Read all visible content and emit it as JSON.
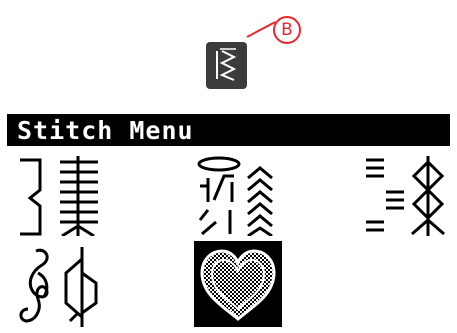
{
  "callout": {
    "label": "B",
    "color": "#e8262d"
  },
  "stitch_button": {
    "icon": "stitch-menu-icon"
  },
  "menu": {
    "title": "Stitch Menu",
    "categories": [
      {
        "icon": "utility-stitches-icon",
        "selected": false
      },
      {
        "icon": "decorative-stitches-icon",
        "selected": false
      },
      {
        "icon": "quilt-stitches-icon",
        "selected": false
      },
      {
        "icon": "ornamental-stitches-icon",
        "selected": false
      },
      {
        "icon": "heart-stitch-icon",
        "selected": true
      }
    ]
  }
}
